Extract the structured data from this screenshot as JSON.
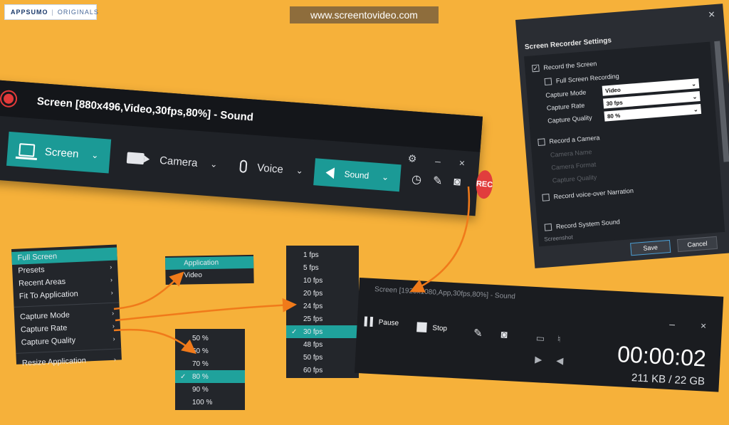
{
  "branding": {
    "logo": "APPSUMO",
    "divider": "|",
    "suffix": "ORIGINALS",
    "url": "www.screentovideo.com"
  },
  "recorder": {
    "title": "Screen [880x496,Video,30fps,80%] - Sound",
    "screen_label": "Screen",
    "camera_label": "Camera",
    "voice_label": "Voice",
    "sound_label": "Sound",
    "rec_label": "REC",
    "minimize": "–",
    "close": "×"
  },
  "settings": {
    "title": "Screen Recorder Settings",
    "close": "×",
    "record_screen": "Record the Screen",
    "full_screen": "Full Screen Recording",
    "capture_mode_label": "Capture Mode",
    "capture_mode_value": "Video",
    "capture_rate_label": "Capture Rate",
    "capture_rate_value": "30 fps",
    "capture_quality_label": "Capture Quality",
    "capture_quality_value": "80 %",
    "record_camera": "Record a Camera",
    "camera_name": "Camera Name",
    "camera_format": "Camera Format",
    "camera_quality": "Capture Quality",
    "record_voice": "Record voice-over Narration",
    "record_sound": "Record System Sound",
    "screenshot": "Screenshot",
    "save": "Save",
    "cancel": "Cancel"
  },
  "context_menu": {
    "items": [
      {
        "label": "Full Screen"
      },
      {
        "label": "Presets"
      },
      {
        "label": "Recent Areas"
      },
      {
        "label": "Fit To Application"
      },
      {
        "label": "Capture Mode"
      },
      {
        "label": "Capture Rate"
      },
      {
        "label": "Capture Quality"
      },
      {
        "label": "Resize Application"
      }
    ]
  },
  "mode_menu": {
    "items": [
      {
        "label": "Application"
      },
      {
        "label": "Video"
      }
    ]
  },
  "quality_menu": {
    "items": [
      {
        "label": "50 %"
      },
      {
        "label": "60 %"
      },
      {
        "label": "70 %"
      },
      {
        "label": "80 %"
      },
      {
        "label": "90 %"
      },
      {
        "label": "100 %"
      }
    ],
    "selected": "80 %"
  },
  "fps_menu": {
    "items": [
      {
        "label": "1 fps"
      },
      {
        "label": "5 fps"
      },
      {
        "label": "10 fps"
      },
      {
        "label": "20 fps"
      },
      {
        "label": "24 fps"
      },
      {
        "label": "25 fps"
      },
      {
        "label": "30 fps"
      },
      {
        "label": "48 fps"
      },
      {
        "label": "50 fps"
      },
      {
        "label": "60 fps"
      }
    ],
    "selected": "30 fps"
  },
  "mini_recorder": {
    "title": "Screen [1920x1080,App,30fps,80%] - Sound",
    "pause_label": "Pause",
    "stop_label": "Stop",
    "timer": "00:00:02",
    "size": "211 KB / 22 GB",
    "minimize": "–",
    "close": "×"
  },
  "colors": {
    "accent": "#1fa29c",
    "record": "#e13d3d",
    "arrow": "#f07a1a",
    "background": "#f6b13a"
  }
}
